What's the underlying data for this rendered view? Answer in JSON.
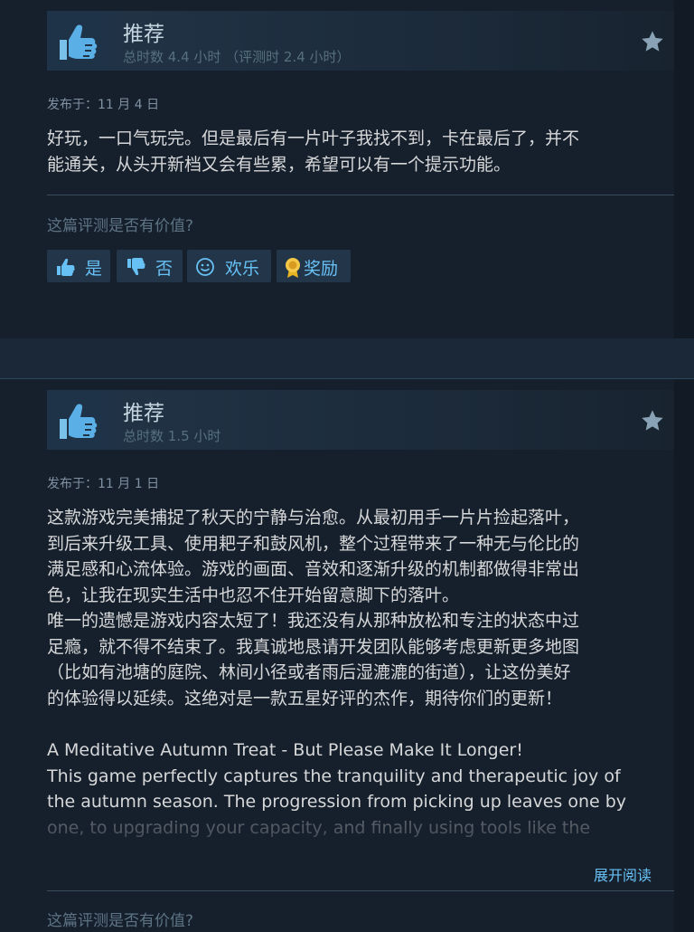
{
  "reviews": [
    {
      "verdict": "推荐",
      "hours": "总时数 4.4 小时 （评测时 2.4 小时）",
      "posted": "发布于：11 月 4 日",
      "body_lines": [
        "好玩，一口气玩完。但是最后有一片叶子我找不到，卡在最后了，并不",
        "能通关，从头开新档又会有些累，希望可以有一个提示功能。"
      ],
      "helpful_question": "这篇评测是否有价值?",
      "buttons": {
        "yes": "是",
        "no": "否",
        "funny": "欢乐",
        "award": "奖励"
      }
    },
    {
      "verdict": "推荐",
      "hours": "总时数 1.5 小时",
      "posted": "发布于：11 月 1 日",
      "body_lines": [
        "这款游戏完美捕捉了秋天的宁静与治愈。从最初用手一片片捡起落叶，",
        "到后来升级工具、使用耙子和鼓风机，整个过程带来了一种无与伦比的",
        "满足感和心流体验。游戏的画面、音效和逐渐升级的机制都做得非常出",
        "色，让我在现实生活中也忍不住开始留意脚下的落叶。",
        "唯一的遗憾是游戏内容太短了！我还没有从那种放松和专注的状态中过",
        "足瘾，就不得不结束了。我真诚地恳请开发团队能够考虑更新更多地图",
        "（比如有池塘的庭院、林间小径或者雨后湿漉漉的街道），让这份美好",
        "的体验得以延续。这绝对是一款五星好评的杰作，期待你们的更新！"
      ],
      "body_en_lines": [
        "A Meditative Autumn Treat - But Please Make It Longer!",
        "This game perfectly captures the tranquility and therapeutic joy of",
        "the autumn season. The progression from picking up leaves one by",
        "one, to upgrading your capacity, and finally using tools like the"
      ],
      "read_more": "展开阅读",
      "helpful_question": "这篇评测是否有价值?"
    }
  ]
}
